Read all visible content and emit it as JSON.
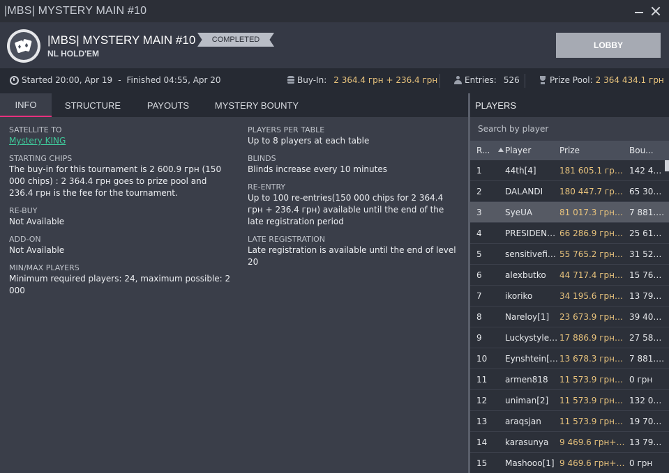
{
  "window": {
    "title": "|MBS| MYSTERY MAIN #10"
  },
  "header": {
    "title": "|MBS| MYSTERY MAIN #10",
    "game_type": "NL HOLD'EM",
    "status": "COMPLETED",
    "lobby_button": "LOBBY"
  },
  "infobar": {
    "started": "Started 20:00, Apr 19",
    "separator": "-",
    "finished": "Finished 04:55, Apr 20",
    "buyin_label": "Buy-In:",
    "buyin_value": "2 364.4 грн + 236.4 грн",
    "entries_label": "Entries:",
    "entries_value": "526",
    "prize_pool_label": "Prize Pool:",
    "prize_pool_value": "2 364 434.1 грн"
  },
  "tabs": [
    "INFO",
    "STRUCTURE",
    "PAYOUTS",
    "MYSTERY BOUNTY"
  ],
  "info": {
    "left": [
      {
        "label": "SATELLITE TO",
        "value": "Mystery KING",
        "link": true
      },
      {
        "label": "STARTING CHIPS",
        "value": "The buy-in for this tournament is 2 600.9 грн (150 000 chips) : 2 364.4 грн goes to prize pool and 236.4 грн is the fee for the tournament."
      },
      {
        "label": "RE-BUY",
        "value": "Not Available"
      },
      {
        "label": "ADD-ON",
        "value": "Not Available"
      },
      {
        "label": "MIN/MAX PLAYERS",
        "value": "Minimum required players: 24, maximum possible: 2 000"
      }
    ],
    "right": [
      {
        "label": "PLAYERS PER TABLE",
        "value": "Up to 8 players at each table"
      },
      {
        "label": "BLINDS",
        "value": "Blinds increase every 10 minutes"
      },
      {
        "label": "RE-ENTRY",
        "value": "Up to 100 re-entries(150 000 chips for 2 364.4 грн + 236.4 грн) available until the end of the late registration period"
      },
      {
        "label": "LATE REGISTRATION",
        "value": "Late registration is available until the end of level 20"
      }
    ]
  },
  "players": {
    "title": "PLAYERS",
    "search_placeholder": "Search by player",
    "columns": {
      "rank": "R...",
      "player": "Player",
      "prize": "Prize",
      "bounty": "Bou..."
    },
    "selected_index": 2,
    "rows": [
      {
        "rank": "1",
        "name": "44th[4]",
        "prize": "181 605.1 грн+...",
        "bounty": "142 430..."
      },
      {
        "rank": "2",
        "name": "DALANDI",
        "prize": "180 447.7 грн+...",
        "bounty": "65 303...."
      },
      {
        "rank": "3",
        "name": "SyeUA",
        "prize": "81 017.3 грн+T...",
        "bounty": "7 881.6 ..."
      },
      {
        "rank": "4",
        "name": "PRESIDENT...",
        "prize": "66 286.9 грн+T...",
        "bounty": "25 614...."
      },
      {
        "rank": "5",
        "name": "sensitivefis...",
        "prize": "55 765.2 грн+T...",
        "bounty": "31 525...."
      },
      {
        "rank": "6",
        "name": "alexbutko",
        "prize": "44 717.4 грн+T...",
        "bounty": "15 763...."
      },
      {
        "rank": "7",
        "name": "ikoriko",
        "prize": "34 195.6 грн+T...",
        "bounty": "13 792...."
      },
      {
        "rank": "8",
        "name": "Nareloy[1]",
        "prize": "23 673.9 грн+T...",
        "bounty": "39 407...."
      },
      {
        "rank": "9",
        "name": "Luckystyle1...",
        "prize": "17 886.9 грн+T...",
        "bounty": "27 585...."
      },
      {
        "rank": "10",
        "name": "Eynshtein[3]",
        "prize": "13 678.3 грн+T...",
        "bounty": "7 881.6 ..."
      },
      {
        "rank": "11",
        "name": "armen818",
        "prize": "11 573.9 грн+T...",
        "bounty": "0 грн"
      },
      {
        "rank": "12",
        "name": "uniman[2]",
        "prize": "11 573.9 грн+T...",
        "bounty": "132 014...."
      },
      {
        "rank": "13",
        "name": "araqsjan",
        "prize": "11 573.9 грн+T...",
        "bounty": "19 703...."
      },
      {
        "rank": "14",
        "name": "karasunya",
        "prize": "9 469.6 грн+Ti...",
        "bounty": "13 792...."
      },
      {
        "rank": "15",
        "name": "Mashooo[1]",
        "prize": "9 469.6 грн+Ti...",
        "bounty": "0 грн"
      }
    ]
  },
  "colors": {
    "accent": "#e8307d",
    "gold": "#e7c27c",
    "link": "#3fc89a"
  }
}
